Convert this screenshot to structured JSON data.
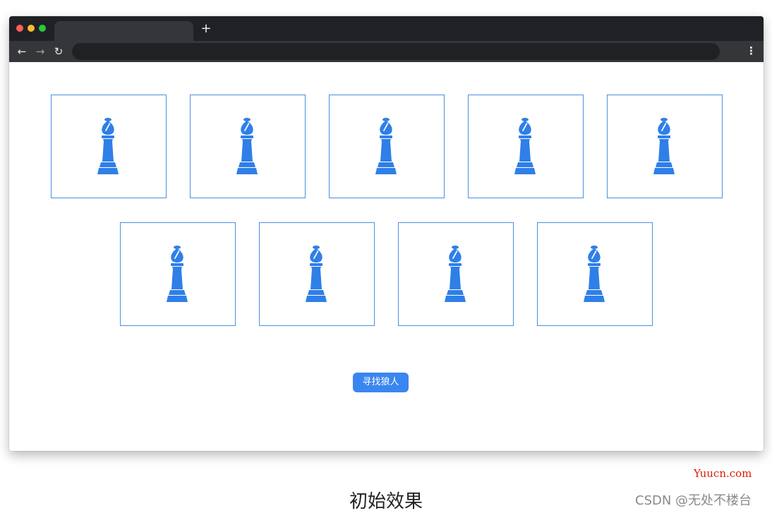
{
  "browser": {
    "controls": {
      "close_color": "#fe5f57",
      "minimize_color": "#febb2e",
      "maximize_color": "#2ac840"
    },
    "new_tab_symbol": "+",
    "nav": {
      "back_symbol": "←",
      "forward_symbol": "→",
      "reload_symbol": "↻",
      "menu_symbol": "⋮"
    }
  },
  "cards": {
    "icon": "chess-bishop-icon",
    "icon_color": "#2f7fe8",
    "border_color": "#4a90e2",
    "rows": [
      5,
      4
    ]
  },
  "action": {
    "label": "寻找狼人",
    "color": "#3a86f0"
  },
  "caption": "初始效果",
  "watermarks": {
    "site": "Yuucn.com",
    "csdn": "CSDN @无处不楼台"
  }
}
